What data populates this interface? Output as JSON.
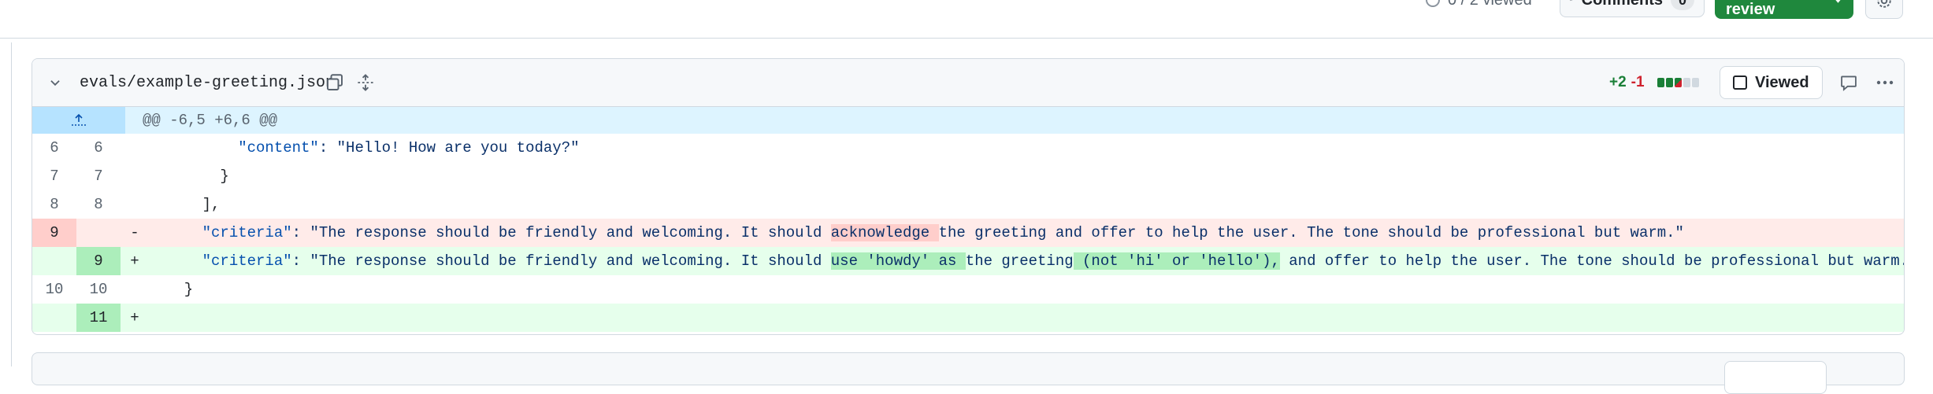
{
  "review_bar": {
    "viewed_progress": "0 / 2 viewed",
    "comments_label": "Comments",
    "comments_count": "0",
    "submit_label": "Submit review"
  },
  "file": {
    "path": "evals/example-greeting.json",
    "additions": "+2",
    "deletions": "-1",
    "diffstat_blocks": [
      "added",
      "added",
      "mixed",
      "neutral",
      "neutral"
    ],
    "viewed_label": "Viewed",
    "hunk_header": "@@ -6,5 +6,6 @@"
  },
  "diff": {
    "r1": {
      "old": "6",
      "new": "6",
      "indent": "        ",
      "key": "\"content\"",
      "value": ": \"Hello! How are you today?\""
    },
    "r2": {
      "old": "7",
      "new": "7",
      "text": "      }"
    },
    "r3": {
      "old": "8",
      "new": "8",
      "text": "    ],"
    },
    "r4": {
      "old": "9",
      "marker": "-",
      "indent": "    ",
      "key": "\"criteria\"",
      "pre": ": \"The response should be friendly and welcoming. It should ",
      "hl": "acknowledge ",
      "post": "the greeting and offer to help the user. The tone should be professional but warm.\""
    },
    "r5": {
      "new": "9",
      "marker": "+",
      "indent": "    ",
      "key": "\"criteria\"",
      "pre": ": \"The response should be friendly and welcoming. It should ",
      "hl1": "use 'howdy' as ",
      "mid": "the greeting",
      "hl2": " (not 'hi' or 'hello'),",
      "post": " and offer to help the user. The tone should be professional but warm.\""
    },
    "r6": {
      "old": "10",
      "new": "10",
      "text": "  }"
    },
    "r7": {
      "new": "11",
      "marker": "+"
    }
  },
  "colors": {
    "addition": "#1a7f37",
    "deletion": "#cf222e",
    "submit": "#1f883d"
  }
}
